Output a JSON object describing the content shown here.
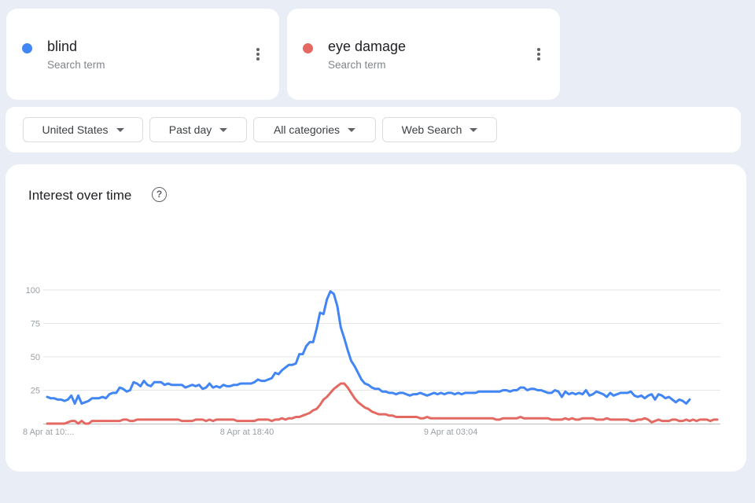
{
  "terms": [
    {
      "name": "blind",
      "subtitle": "Search term",
      "color": "#4285f4"
    },
    {
      "name": "eye damage",
      "subtitle": "Search term",
      "color": "#e46962"
    }
  ],
  "filters": [
    {
      "label": "United States"
    },
    {
      "label": "Past day"
    },
    {
      "label": "All categories"
    },
    {
      "label": "Web Search"
    }
  ],
  "chart_card": {
    "title": "Interest over time",
    "help_icon": "help-circle-icon",
    "help_glyph": "?"
  },
  "chart_data": {
    "type": "line",
    "title": "Interest over time",
    "xlabel": "",
    "ylabel": "",
    "ylim": [
      0,
      100
    ],
    "yticks": [
      25,
      50,
      75,
      100
    ],
    "grid": true,
    "legend": "none (terms shown in cards above)",
    "x_tick_labels": [
      {
        "label": "8 Apr at 10:...",
        "index": 0
      },
      {
        "label": "8 Apr at 18:40",
        "index": 58
      },
      {
        "label": "9 Apr at 03:04",
        "index": 117
      }
    ],
    "series": [
      {
        "name": "blind",
        "color": "#4285f4",
        "values": [
          20,
          19,
          19,
          18,
          18,
          17,
          18,
          21,
          15,
          21,
          15,
          16,
          17,
          19,
          19,
          19,
          20,
          19,
          22,
          23,
          23,
          27,
          26,
          24,
          25,
          31,
          30,
          28,
          32,
          29,
          28,
          31,
          31,
          31,
          29,
          30,
          29,
          29,
          29,
          29,
          27,
          28,
          29,
          28,
          29,
          26,
          27,
          30,
          27,
          28,
          27,
          29,
          28,
          28,
          29,
          29,
          30,
          30,
          30,
          30,
          31,
          33,
          32,
          32,
          33,
          34,
          38,
          37,
          40,
          42,
          44,
          44,
          45,
          52,
          52,
          58,
          61,
          61,
          71,
          83,
          82,
          93,
          99,
          97,
          88,
          72,
          64,
          55,
          47,
          43,
          38,
          33,
          30,
          29,
          27,
          26,
          26,
          24,
          24,
          23,
          23,
          22,
          23,
          23,
          22,
          21,
          22,
          22,
          23,
          22,
          21,
          22,
          23,
          22,
          23,
          22,
          23,
          23,
          22,
          23,
          22,
          23,
          23,
          23,
          23,
          24,
          24,
          24,
          24,
          24,
          24,
          24,
          25,
          25,
          24,
          25,
          25,
          27,
          27,
          25,
          26,
          26,
          25,
          25,
          24,
          23,
          23,
          25,
          24,
          20,
          24,
          22,
          23,
          22,
          23,
          22,
          25,
          21,
          22,
          24,
          23,
          22,
          20,
          23,
          21,
          22,
          23,
          23,
          23,
          24,
          21,
          20,
          21,
          19,
          21,
          22,
          18,
          22,
          21,
          19,
          20,
          18,
          16,
          18,
          17,
          15,
          18
        ],
        "min_count": 0
      },
      {
        "name": "eye damage",
        "color": "#e46962",
        "values": [
          0,
          0,
          0,
          0,
          0,
          0,
          1,
          2,
          2,
          0,
          2,
          0,
          0,
          2,
          2,
          2,
          2,
          2,
          2,
          2,
          2,
          2,
          3,
          3,
          2,
          2,
          3,
          3,
          3,
          3,
          3,
          3,
          3,
          3,
          3,
          3,
          3,
          3,
          3,
          2,
          2,
          2,
          2,
          3,
          3,
          3,
          2,
          3,
          2,
          3,
          3,
          3,
          3,
          3,
          3,
          2,
          2,
          2,
          2,
          2,
          2,
          3,
          3,
          3,
          3,
          2,
          3,
          3,
          4,
          3,
          4,
          4,
          5,
          5,
          6,
          7,
          8,
          10,
          11,
          14,
          18,
          20,
          23,
          26,
          28,
          30,
          30,
          27,
          23,
          19,
          16,
          14,
          12,
          11,
          9,
          8,
          7,
          7,
          7,
          6,
          6,
          5,
          5,
          5,
          5,
          5,
          5,
          5,
          4,
          4,
          5,
          4,
          4,
          4,
          4,
          4,
          4,
          4,
          4,
          4,
          4,
          4,
          4,
          4,
          4,
          4,
          4,
          4,
          4,
          4,
          3,
          3,
          4,
          4,
          4,
          4,
          4,
          5,
          4,
          4,
          4,
          4,
          4,
          4,
          4,
          4,
          3,
          3,
          3,
          3,
          4,
          3,
          4,
          3,
          3,
          4,
          4,
          4,
          4,
          3,
          3,
          3,
          4,
          3,
          3,
          3,
          3,
          3,
          3,
          2,
          2,
          3,
          3,
          4,
          3,
          1,
          2,
          3,
          2,
          2,
          2,
          3,
          3,
          2,
          2,
          3,
          2,
          3,
          2,
          3,
          3,
          3,
          2,
          3,
          3
        ]
      }
    ]
  }
}
